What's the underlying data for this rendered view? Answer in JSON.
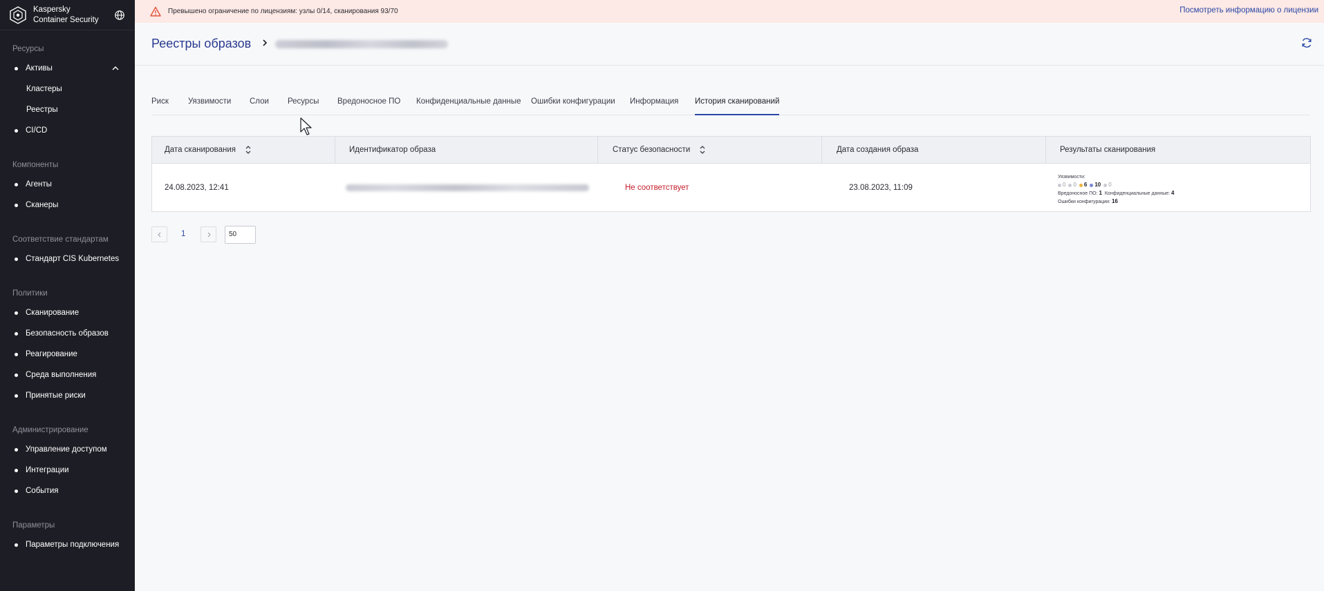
{
  "app": {
    "brand_line1": "Kaspersky",
    "brand_line2": "Container Security"
  },
  "sidebar": {
    "groups": [
      {
        "title": "Ресурсы",
        "items": [
          {
            "label": "Активы",
            "dot": true,
            "expanded": true
          },
          {
            "label": "Кластеры",
            "dot": false
          },
          {
            "label": "Реестры",
            "dot": false
          },
          {
            "label": "CI/CD",
            "dot": true
          }
        ]
      },
      {
        "title": "Компоненты",
        "items": [
          {
            "label": "Агенты",
            "dot": true
          },
          {
            "label": "Сканеры",
            "dot": true
          }
        ]
      },
      {
        "title": "Соответствие стандартам",
        "items": [
          {
            "label": "Стандарт CIS Kubernetes",
            "dot": true
          }
        ]
      },
      {
        "title": "Политики",
        "items": [
          {
            "label": "Сканирование",
            "dot": true
          },
          {
            "label": "Безопасность образов",
            "dot": true
          },
          {
            "label": "Реагирование",
            "dot": true
          },
          {
            "label": "Среда выполнения",
            "dot": true
          },
          {
            "label": "Принятые риски",
            "dot": true
          }
        ]
      },
      {
        "title": "Администрирование",
        "items": [
          {
            "label": "Управление доступом",
            "dot": true
          },
          {
            "label": "Интеграции",
            "dot": true
          },
          {
            "label": "События",
            "dot": true
          }
        ]
      },
      {
        "title": "Параметры",
        "items": [
          {
            "label": "Параметры подключения",
            "dot": true
          }
        ]
      }
    ]
  },
  "banner": {
    "text": "Превышено ограничение по лицензиям: узлы 0/14, сканирования 93/70",
    "link": "Посмотреть информацию о лицензии",
    "color": "#fde9e5"
  },
  "header": {
    "breadcrumb_root": "Реестры образов"
  },
  "tabs": [
    {
      "label": "Риск"
    },
    {
      "label": "Уязвимости"
    },
    {
      "label": "Слои"
    },
    {
      "label": "Ресурсы"
    },
    {
      "label": "Вредоносное ПО"
    },
    {
      "label": "Конфиденциальные данные"
    },
    {
      "label": "Ошибки конфигурации"
    },
    {
      "label": "Информация"
    },
    {
      "label": "История сканирований",
      "active": true
    }
  ],
  "table": {
    "columns": [
      {
        "label": "Дата сканирования",
        "sortable": true
      },
      {
        "label": "Идентификатор образа",
        "sortable": false
      },
      {
        "label": "Статус безопасности",
        "sortable": true
      },
      {
        "label": "Дата создания образа",
        "sortable": false
      },
      {
        "label": "Результаты сканирования",
        "sortable": false
      }
    ],
    "rows": [
      {
        "scan_date": "24.08.2023, 12:41",
        "status": "Не соответствует",
        "created": "23.08.2023, 11:09",
        "results": {
          "vuln_label": "Уязвимости:",
          "vuln_counts": [
            {
              "value": "0",
              "color": "#c9cad3"
            },
            {
              "value": "0",
              "color": "#c9cad3"
            },
            {
              "value": "6",
              "color": "#f0b43c"
            },
            {
              "value": "10",
              "color": "#7a86d6"
            },
            {
              "value": "0",
              "color": "#c9cad3"
            }
          ],
          "malware_label": "Вредоносное ПО:",
          "malware_value": "1",
          "sensitive_label": "Конфиденциальные данные:",
          "sensitive_value": "4",
          "misconfig_label": "Ошибки конфигурации:",
          "misconfig_value": "16"
        }
      }
    ]
  },
  "pagination": {
    "current_page": "1",
    "page_size": "50"
  },
  "colors": {
    "sidebar_bg": "#1d1d25",
    "accent": "#2a47a6",
    "danger": "#c4202c"
  }
}
